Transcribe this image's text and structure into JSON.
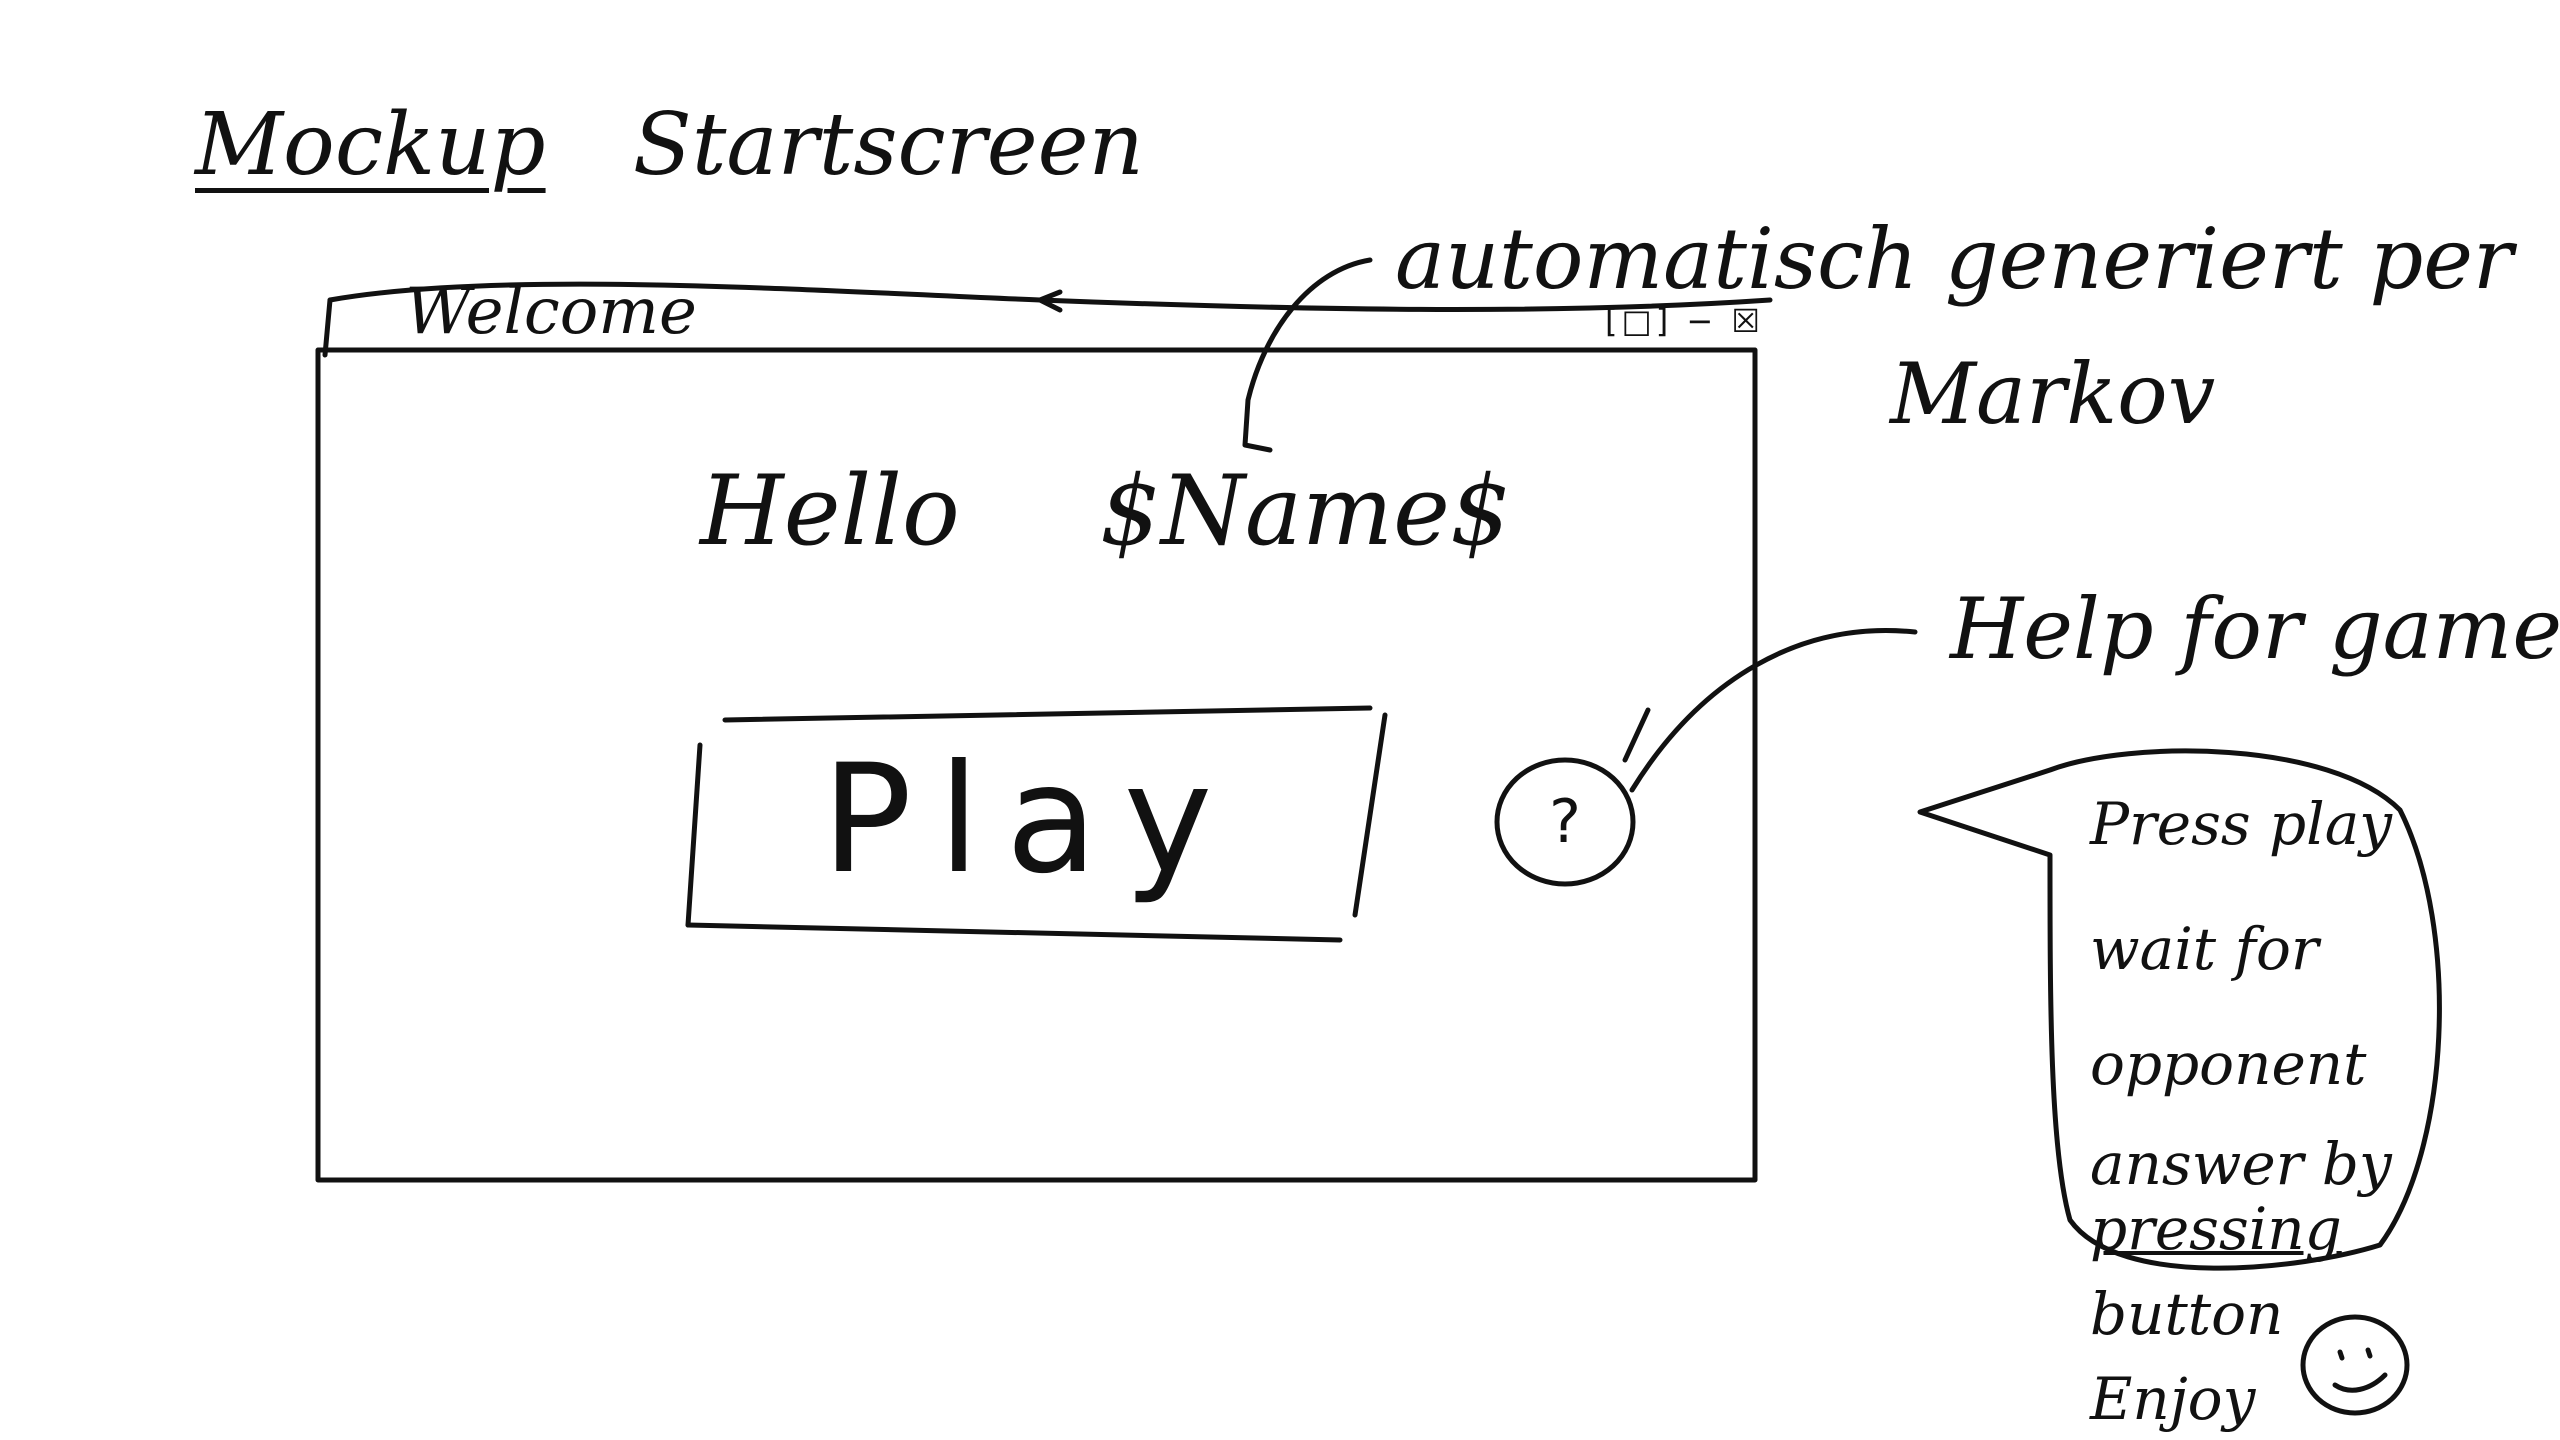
{
  "heading": {
    "word1": "Mockup",
    "word2": "Startscreen"
  },
  "window": {
    "title": "Welcome",
    "controls": "[□] − ☒"
  },
  "greeting": {
    "hello": "Hello",
    "name_placeholder": "$Name$"
  },
  "play_button": {
    "label": "Play"
  },
  "help_icon": {
    "glyph": "?"
  },
  "annotation": {
    "line1": "automatisch generiert per",
    "line2": "Markov"
  },
  "help_label": "Help for game",
  "help_bubble": {
    "lines": [
      "Press play",
      "wait for",
      "opponent",
      "answer by",
      "pressing",
      "button",
      "Enjoy"
    ]
  },
  "icons": {
    "smiley": "smiley-icon",
    "arrow": "arrow-icon"
  }
}
